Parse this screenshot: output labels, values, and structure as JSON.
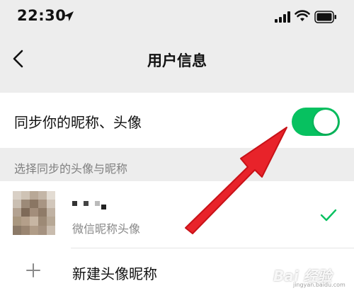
{
  "status_bar": {
    "time": "22:30",
    "icons": [
      "location-arrow-icon",
      "cellular-signal-icon",
      "wifi-icon",
      "battery-icon"
    ]
  },
  "nav": {
    "title": "用户信息",
    "back_icon": "chevron-left-icon"
  },
  "sync": {
    "label": "同步你的昵称、头像",
    "enabled": true,
    "toggle_color": "#07c160"
  },
  "section": {
    "header": "选择同步的头像与昵称"
  },
  "options": [
    {
      "subtitle": "微信昵称头像",
      "selected": true,
      "check_color": "#07c160"
    },
    {
      "label": "新建头像昵称",
      "icon": "plus-icon"
    }
  ],
  "annotation": {
    "arrow_color": "#e8232a"
  },
  "watermark": {
    "text": "Bai 经验",
    "sub": "jingyan.baidu.com"
  }
}
